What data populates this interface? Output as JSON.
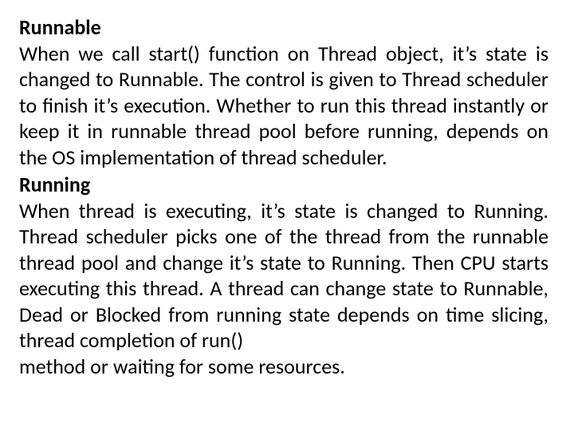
{
  "sections": {
    "runnable": {
      "heading": "Runnable",
      "body": "When we call start() function on Thread object, it’s state is changed to Runnable. The control is given to Thread scheduler to finish it’s execution. Whether to run this thread instantly or keep it in runnable thread pool before running, depends on the OS implementation of thread scheduler."
    },
    "running": {
      "heading": "Running",
      "body1": "When thread is executing, it’s state is changed to Running. Thread scheduler picks one of the thread from the runnable thread pool and change it’s state to Running. Then CPU starts executing this thread. A thread can change state to Runnable, Dead or Blocked from running state depends on time slicing, thread completion of run()",
      "body2": "method or waiting for some resources."
    }
  }
}
